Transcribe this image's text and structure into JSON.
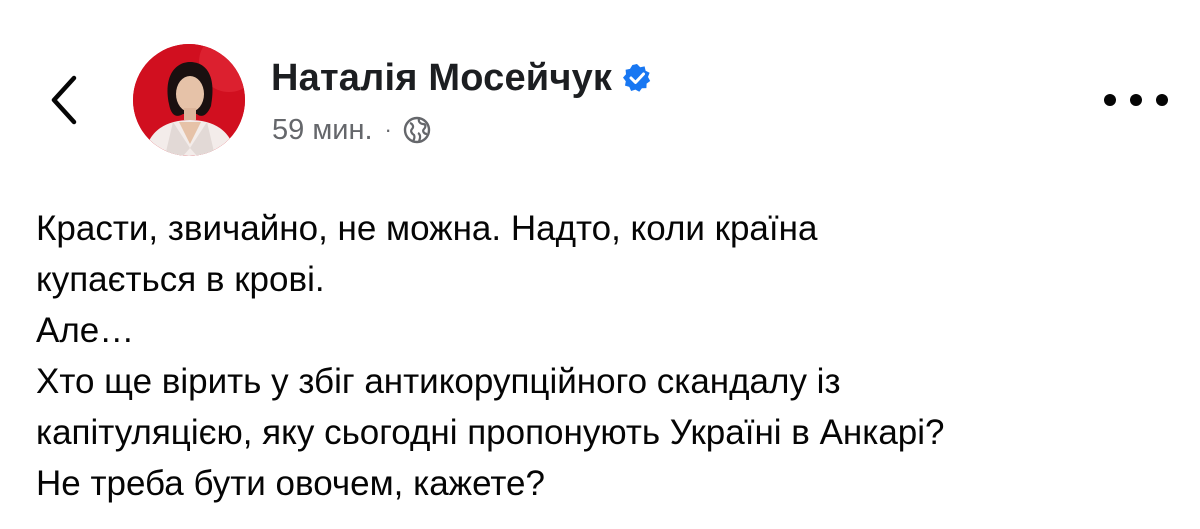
{
  "post": {
    "author": {
      "name": "Наталія Мосейчук",
      "verified": true,
      "avatar_background": "#d10f1f"
    },
    "meta": {
      "time": "59 мин.",
      "separator": "·",
      "audience_icon": "globe-icon"
    },
    "paragraphs": [
      "Красти, звичайно, не можна. Надто, коли країна\nкупається в крові.",
      "Але…",
      "Хто ще вірить у збіг антикорупційного скандалу із\nкапітуляцією, яку сьогодні пропонують Україні в Анкарі?",
      "Не треба бути овочем, кажете?"
    ]
  },
  "icons": {
    "back": "chevron-left-icon",
    "more": "more-horizontal-icon",
    "verified": "verified-badge-icon"
  },
  "colors": {
    "verified_blue": "#1877f2",
    "secondary_text": "#65676b",
    "primary_text": "#050505"
  }
}
